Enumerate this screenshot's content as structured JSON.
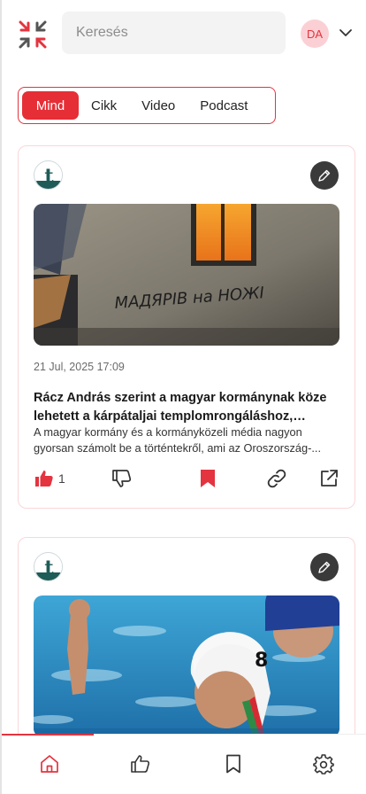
{
  "header": {
    "search_placeholder": "Keresés",
    "avatar_initials": "DA"
  },
  "filter_tabs": [
    {
      "label": "Mind",
      "active": true
    },
    {
      "label": "Cikk",
      "active": false
    },
    {
      "label": "Video",
      "active": false
    },
    {
      "label": "Podcast",
      "active": false
    }
  ],
  "articles": [
    {
      "source_icon": "telex-t-logo",
      "date": "21 Jul, 2025 17:09",
      "image_text": "МАДЯРІВ на НОЖІ",
      "title": "Rácz András szerint a magyar kormánynak köze lehetett a kárpátaljai templomrongáláshoz, Mencz...",
      "excerpt": "A magyar kormány és a kormányközeli média nagyon gyorsan számolt be a történtekről, ami az Oroszország-...",
      "likes": "1",
      "liked": true,
      "bookmarked": true
    },
    {
      "source_icon": "telex-t-logo",
      "image_alt": "water-polo-player"
    }
  ],
  "colors": {
    "accent": "#e3343f",
    "card_border": "#fbd6d9",
    "avatar_bg": "#fbd0d4"
  },
  "bottom_nav": [
    {
      "icon": "home-icon",
      "active": true
    },
    {
      "icon": "thumbs-up-icon",
      "active": false
    },
    {
      "icon": "bookmark-icon",
      "active": false
    },
    {
      "icon": "gear-icon",
      "active": false
    }
  ]
}
